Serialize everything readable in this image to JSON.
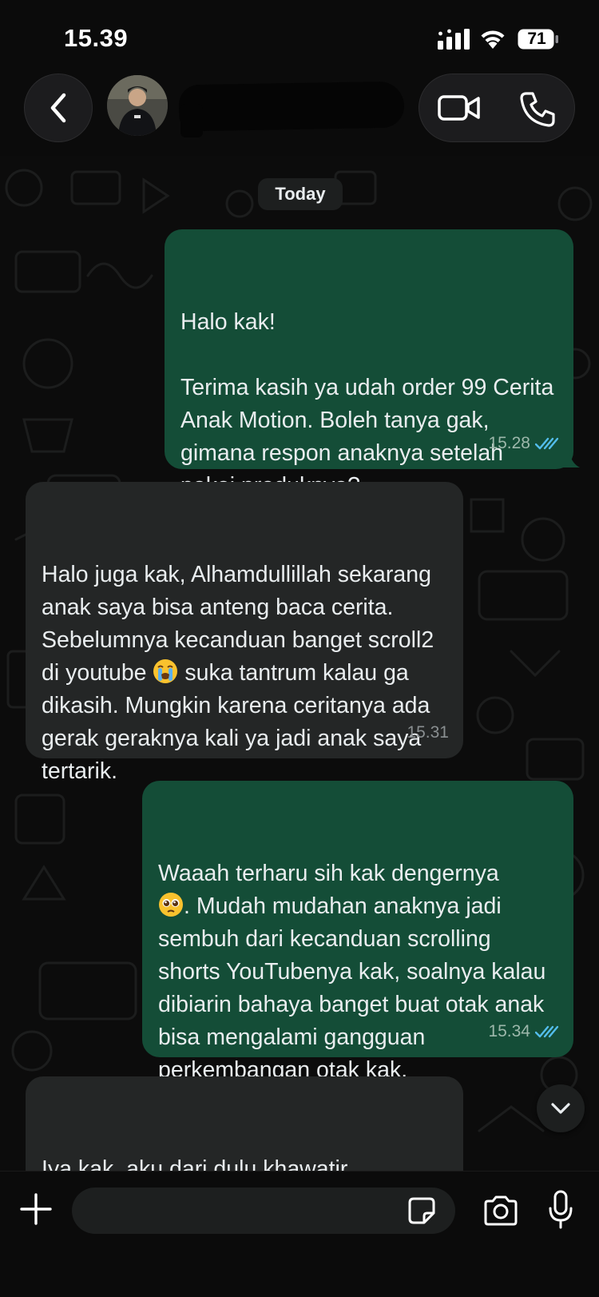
{
  "status_bar": {
    "time": "15.39",
    "battery": "71"
  },
  "header": {
    "contact_name": "",
    "icons": [
      "back-icon",
      "avatar",
      "video-call-icon",
      "voice-call-icon"
    ]
  },
  "chat": {
    "date_chip": "Today",
    "messages": [
      {
        "direction": "out",
        "text": "Halo kak!\n\nTerima kasih ya udah order 99 Cerita Anak Motion. Boleh tanya gak, gimana respon anaknya setelah pakai produknya?",
        "time": "15.28",
        "read": true
      },
      {
        "direction": "in",
        "text_before_emoji": "Halo juga kak, Alhamdullillah sekarang anak saya bisa anteng baca cerita. Sebelumnya kecanduan banget scroll2 di youtube ",
        "emoji": "loudly-crying-face",
        "text_after_emoji": " suka tantrum kalau ga dikasih. Mungkin karena ceritanya ada gerak geraknya kali ya jadi anak saya tertarik.",
        "time": "15.31"
      },
      {
        "direction": "out",
        "text_before_emoji": "Waaah terharu sih kak dengernya\n",
        "emoji": "pleading-face",
        "text_after_emoji": ". Mudah mudahan anaknya jadi sembuh dari kecanduan scrolling shorts YouTubenya kak, soalnya kalau dibiarin bahaya banget buat otak anak bisa mengalami gangguan perkembangan otak kak.",
        "time": "15.34",
        "read": true
      },
      {
        "direction": "in",
        "text": "Iya kak, aku dari dulu khawatir\nbanget sebenernya, tapi gatau",
        "time": ""
      }
    ]
  },
  "input_bar": {
    "placeholder": "",
    "value": ""
  },
  "colors": {
    "outgoing_bubble": "#144d37",
    "incoming_bubble": "#242626",
    "read_ticks": "#53bdeb",
    "background": "#0b0b0b"
  }
}
